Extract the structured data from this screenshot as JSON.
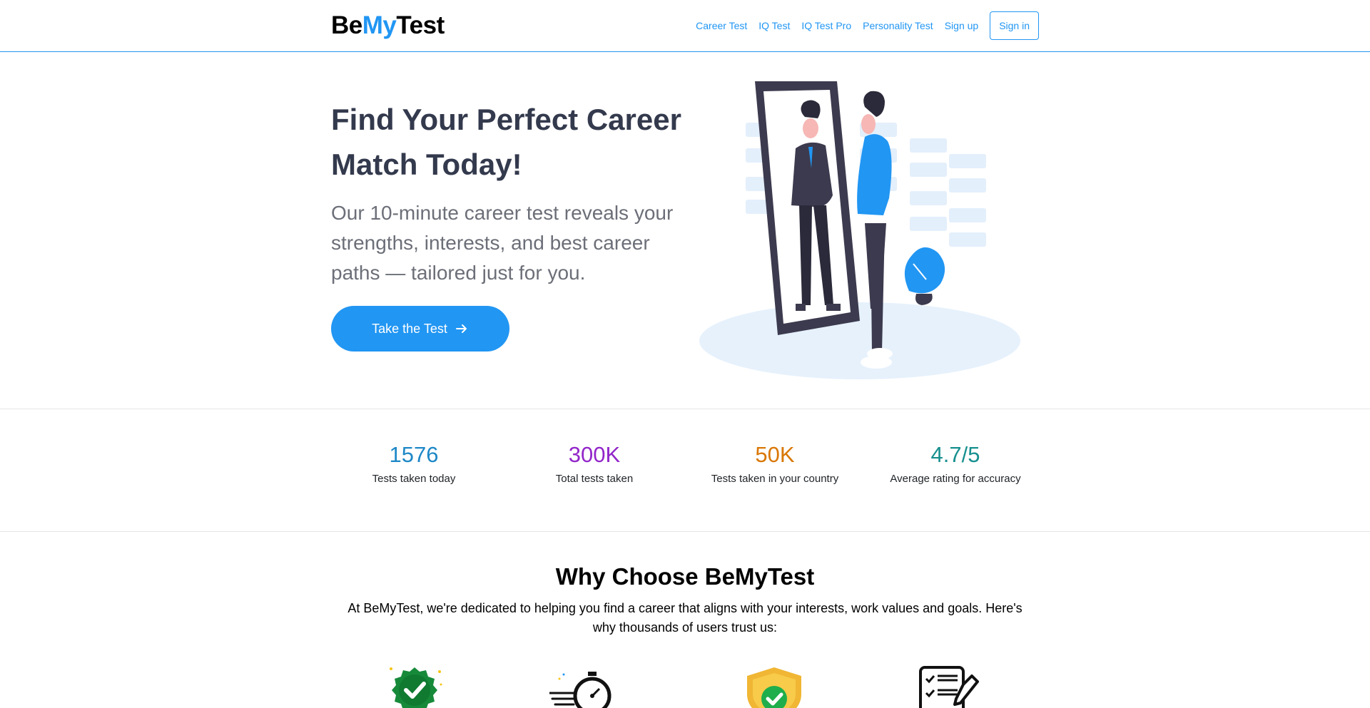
{
  "brand": {
    "part1": "Be",
    "part2": "My",
    "part3": "Test",
    "accent": "#2196f3"
  },
  "nav": {
    "items": [
      "Career Test",
      "IQ Test",
      "IQ Test Pro",
      "Personality Test",
      "Sign up"
    ],
    "signin": "Sign in"
  },
  "hero": {
    "title": "Find Your Perfect Career Match Today!",
    "subtitle": "Our 10-minute career test reveals your strengths, interests, and best career paths — tailored just for you.",
    "cta": "Take the Test",
    "cta_icon": "arrow-right-icon",
    "illustration": "person-looking-in-mirror-illustration"
  },
  "stats": [
    {
      "value": "1576",
      "label": "Tests taken today",
      "color": "#1e88c7"
    },
    {
      "value": "300K",
      "label": "Total tests taken",
      "color": "#9226c9"
    },
    {
      "value": "50K",
      "label": "Tests taken in your country",
      "color": "#d97706"
    },
    {
      "value": "4.7/5",
      "label": "Average rating for accuracy",
      "color": "#17908f"
    }
  ],
  "why": {
    "title": "Why Choose BeMyTest",
    "text": "At BeMyTest, we're dedicated to helping you find a career that aligns with your interests, work values and goals. Here's why thousands of users trust us:",
    "icons": [
      "verified-badge-icon",
      "stopwatch-icon",
      "shield-check-icon",
      "checklist-icon"
    ]
  }
}
